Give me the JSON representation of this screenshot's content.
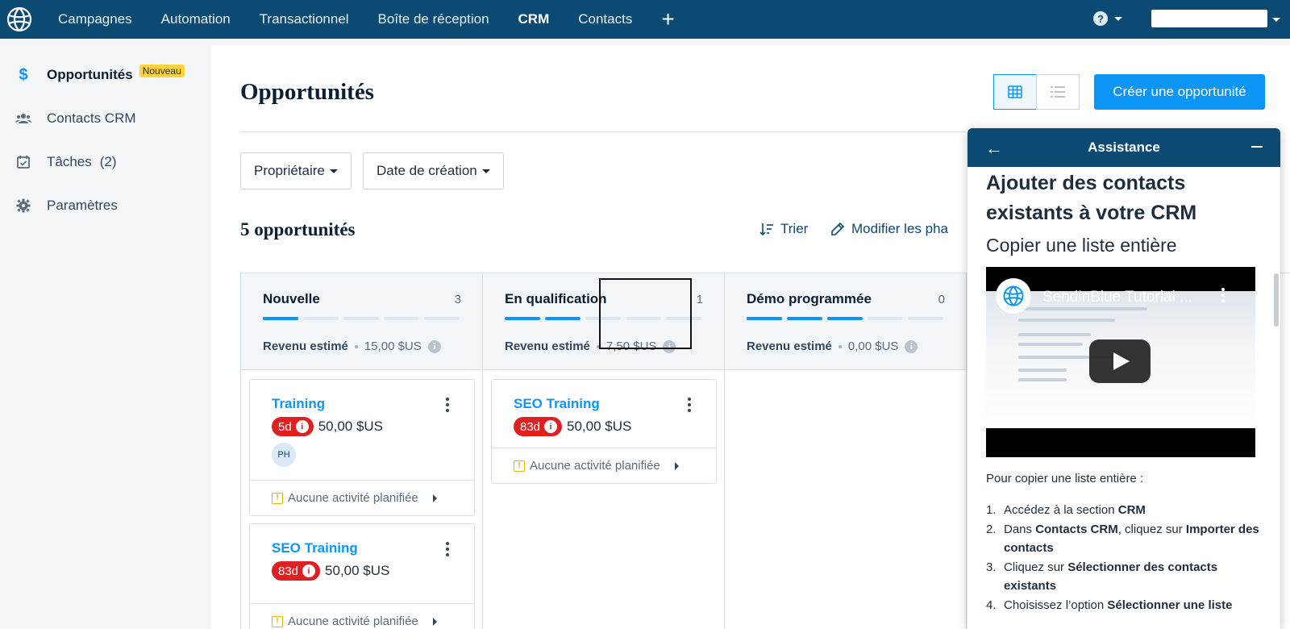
{
  "nav": {
    "items": [
      "Campagnes",
      "Automation",
      "Transactionnel",
      "Boîte de réception",
      "CRM",
      "Contacts"
    ],
    "active": "CRM",
    "help_icon": "question-circle-icon"
  },
  "sidebar": {
    "items": [
      {
        "label": "Opportunités",
        "icon": "dollar-icon",
        "badge": "Nouveau",
        "count": ""
      },
      {
        "label": "Contacts CRM",
        "icon": "users-icon",
        "badge": "",
        "count": ""
      },
      {
        "label": "Tâches",
        "icon": "calendar-check-icon",
        "badge": "",
        "count": "(2)"
      },
      {
        "label": "Paramètres",
        "icon": "gear-icon",
        "badge": "",
        "count": ""
      }
    ]
  },
  "page": {
    "title": "Opportunités",
    "create_label": "Créer une opportunité",
    "filters": [
      "Propriétaire",
      "Date de création"
    ],
    "count_title": "5 opportunités",
    "sort_label": "Trier",
    "modify_label": "Modifier les pha"
  },
  "columns": [
    {
      "name": "Nouvelle",
      "count": "3",
      "progress": 1,
      "segments": 5,
      "revenue_label": "Revenu estimé",
      "revenue": "15,00 $US"
    },
    {
      "name": "En qualification",
      "count": "1",
      "progress": 2,
      "segments": 5,
      "revenue_label": "Revenu estimé",
      "revenue": "7,50 $US"
    },
    {
      "name": "Démo programmée",
      "count": "0",
      "progress": 3,
      "segments": 5,
      "revenue_label": "Revenu estimé",
      "revenue": "0,00 $US"
    }
  ],
  "cards": [
    {
      "title": "Training",
      "late": "5d",
      "amount": "50,00 $US",
      "avatar": "PH",
      "footer": "Aucune activité planifiée"
    },
    {
      "title": "SEO Training",
      "late": "83d",
      "amount": "50,00 $US",
      "avatar": "",
      "footer": "Aucune activité planifiée"
    },
    {
      "title": "SEO Training",
      "late": "83d",
      "amount": "50,00 $US",
      "avatar": "",
      "footer": "Aucune activité planifiée"
    }
  ],
  "assistance": {
    "title": "Assistance",
    "heading": "Ajouter des contacts existants à votre CRM",
    "subheading": "Copier une liste entière",
    "video_title": "SendinBlue Tutorial ...",
    "intro": "Pour copier une liste entière :",
    "steps": [
      {
        "num": "1.",
        "pre": "Accédez à la section ",
        "bold": "CRM",
        "mid": "",
        "bold2": ""
      },
      {
        "num": "2.",
        "pre": "Dans ",
        "bold": "Contacts CRM",
        "mid": ", cliquez sur ",
        "bold2": "Importer des contacts"
      },
      {
        "num": "3.",
        "pre": "Cliquez sur ",
        "bold": "Sélectionner des contacts existants",
        "mid": "",
        "bold2": ""
      },
      {
        "num": "4.",
        "pre": "Choisissez l’option ",
        "bold": "Sélectionner une liste",
        "mid": "",
        "bold2": ""
      }
    ]
  },
  "colors": {
    "nav_bg": "#0b4a72",
    "accent": "#0b96f5",
    "late": "#e02020",
    "badge": "#ffd43b"
  }
}
